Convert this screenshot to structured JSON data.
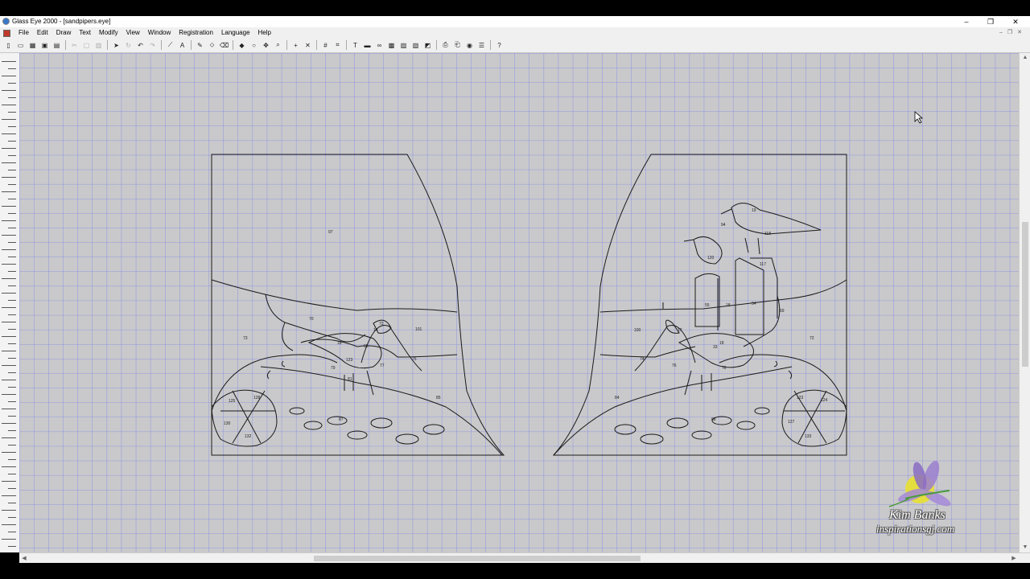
{
  "window": {
    "title": "Glass Eye 2000 - [sandpipers.eye]",
    "controls": {
      "minimize": "–",
      "restore": "❐",
      "close": "✕"
    }
  },
  "menu": [
    "File",
    "Edit",
    "Draw",
    "Text",
    "Modify",
    "View",
    "Window",
    "Registration",
    "Language",
    "Help"
  ],
  "toolbar": {
    "icons": [
      "new-icon",
      "open-icon",
      "grid-icon",
      "save-icon",
      "save-as-icon",
      "cut-icon",
      "copy-icon",
      "paste-icon",
      "pointer-icon",
      "rotate-icon",
      "undo-icon",
      "redo-icon",
      "line-icon",
      "text-tool-icon",
      "pencil-icon",
      "fill-icon",
      "eraser-icon",
      "node-icon",
      "circle-icon",
      "move-icon",
      "zoom-icon",
      "cross-icon",
      "x-icon",
      "grid-snap-icon",
      "grid-toggle-icon",
      "align-icon",
      "break-icon",
      "link-icon",
      "pattern-icon",
      "texture-icon",
      "color-icon",
      "render-icon",
      "print-icon",
      "preview-icon",
      "export-icon",
      "cut-list-icon",
      "help-pointer-icon"
    ]
  },
  "pattern": {
    "piece_numbers_left": [
      "97",
      "70",
      "73",
      "72",
      "68",
      "18",
      "14",
      "101",
      "75",
      "77",
      "79",
      "123",
      "81",
      "85",
      "125",
      "128",
      "130",
      "132",
      "87"
    ],
    "piece_numbers_right": [
      "19",
      "94",
      "118",
      "120",
      "117",
      "55",
      "18",
      "54",
      "69",
      "72",
      "100",
      "74",
      "17",
      "18",
      "33",
      "76",
      "78",
      "84",
      "88",
      "123",
      "124",
      "127",
      "133"
    ]
  },
  "watermark": {
    "line1": "Kim Banks",
    "line2": "inspirationsgj.com"
  },
  "colors": {
    "grid": "#7f86e6",
    "workspace": "#c9c9cb",
    "pattern_line": "#1a1a1a"
  }
}
